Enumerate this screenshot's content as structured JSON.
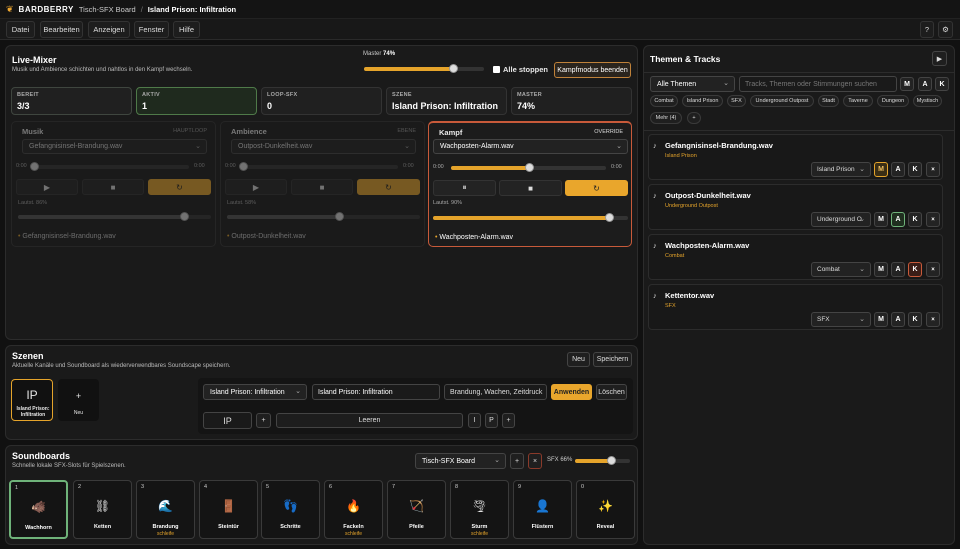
{
  "titlebar": {
    "brand": "BARDBERRY",
    "board": "Tisch-SFX Board",
    "separator": "/",
    "scene": "Island Prison: Infiltration"
  },
  "menu": [
    "Datei",
    "Bearbeiten",
    "Anzeigen",
    "Fenster",
    "Hilfe"
  ],
  "topright": {
    "help": "?",
    "settings": "⚙"
  },
  "mixer": {
    "title": "Live-Mixer",
    "subtitle": "Musik und Ambience schichten und nahtlos in den Kampf wechseln.",
    "master_label": "Master",
    "master_value": "74%",
    "master_level": 0.74,
    "stop_all": "Alle stoppen",
    "combat_end": "Kampfmodus beenden",
    "stats": [
      {
        "label": "BEREIT",
        "value": "3/3"
      },
      {
        "label": "AKTIV",
        "value": "1"
      },
      {
        "label": "LOOP-SFX",
        "value": "0"
      },
      {
        "label": "SZENE",
        "value": "Island Prison: Infiltration"
      },
      {
        "label": "MASTER",
        "value": "74%"
      }
    ],
    "channels": [
      {
        "name": "Musik",
        "tag": "HAUPTLOOP",
        "track": "Gefangnisinsel-Brandung.wav",
        "t_start": "0:00",
        "t_end": "0:00",
        "progress": 0,
        "volume_label": "Lautst. 86%",
        "volume": 0.86,
        "now": "Gefangnisinsel-Brandung.wav"
      },
      {
        "name": "Ambience",
        "tag": "EBENE",
        "track": "Outpost-Dunkelheit.wav",
        "t_start": "0:00",
        "t_end": "0:00",
        "progress": 0,
        "volume_label": "Lautst. 58%",
        "volume": 0.58,
        "now": "Outpost-Dunkelheit.wav"
      },
      {
        "name": "Kampf",
        "tag": "OVERRIDE",
        "track": "Wachposten-Alarm.wav",
        "t_start": "0:00",
        "t_end": "0:00",
        "progress": 0.5,
        "volume_label": "Lautst. 90%",
        "volume": 0.9,
        "now": "Wachposten-Alarm.wav"
      }
    ],
    "colors": {
      "accent": "#e9a62c",
      "ready": "#3f4a3f",
      "active": "#3e5b3a",
      "combat": "#c85a3a"
    }
  },
  "scenes": {
    "title": "Szenen",
    "subtitle": "Aktuelle Kanäle und Soundboard als wiederverwendbares Soundscape speichern.",
    "new": "Neu",
    "save": "Speichern",
    "card": {
      "abbr": "IP",
      "label": "Island Prison: Infiltration"
    },
    "new_card": {
      "plus": "+",
      "label": "Neu"
    },
    "select": "Island Prison: Infiltration",
    "name_value": "Island Prison: Infiltration",
    "tags_value": "Brandung, Wachen, Zeitdruck",
    "apply": "Anwenden",
    "delete": "Löschen",
    "abbr_value": "IP",
    "plus": "+",
    "clear": "Leeren",
    "i": "I",
    "p": "P",
    "plus2": "+"
  },
  "soundboards": {
    "title": "Soundboards",
    "subtitle": "Schnelle lokale SFX-Slots für Spielszenen.",
    "board": "Tisch-SFX Board",
    "plus": "+",
    "close": "×",
    "sfx_label": "SFX 66%",
    "sfx_level": 0.66,
    "slots": [
      {
        "num": "1",
        "icon": "🐗",
        "label": "Wachhorn",
        "sub": ""
      },
      {
        "num": "2",
        "icon": "⛓",
        "label": "Ketten",
        "sub": ""
      },
      {
        "num": "3",
        "icon": "🌊",
        "label": "Brandung",
        "sub": "schleife"
      },
      {
        "num": "4",
        "icon": "🚪",
        "label": "Steintür",
        "sub": ""
      },
      {
        "num": "5",
        "icon": "👣",
        "label": "Schritte",
        "sub": ""
      },
      {
        "num": "6",
        "icon": "🔥",
        "label": "Fackeln",
        "sub": "schleife"
      },
      {
        "num": "7",
        "icon": "🏹",
        "label": "Pfeile",
        "sub": ""
      },
      {
        "num": "8",
        "icon": "🌪",
        "label": "Sturm",
        "sub": "schleife"
      },
      {
        "num": "9",
        "icon": "👤",
        "label": "Flüstern",
        "sub": ""
      },
      {
        "num": "0",
        "icon": "✨",
        "label": "Reveal",
        "sub": ""
      }
    ]
  },
  "themes": {
    "title": "Themen & Tracks",
    "play": "▶",
    "filter": "Alle Themen",
    "search_placeholder": "Tracks, Themen oder Stimmungen suchen",
    "mkk": [
      "M",
      "A",
      "K"
    ],
    "chips": [
      "Combat",
      "Island Prison",
      "SFX",
      "Underground Outpost",
      "Stadt",
      "Taverne",
      "Dungeon",
      "Mystisch"
    ],
    "more": "Mehr (4)",
    "more_plus": "+",
    "tracks": [
      {
        "name": "Gefangnisinsel-Brandung.wav",
        "tag": "Island Prison",
        "theme": "Island Prison",
        "active": "M"
      },
      {
        "name": "Outpost-Dunkelheit.wav",
        "tag": "Underground Outpost",
        "theme": "Underground O",
        "active": "A"
      },
      {
        "name": "Wachposten-Alarm.wav",
        "tag": "Combat",
        "theme": "Combat",
        "active": "K"
      },
      {
        "name": "Kettentor.wav",
        "tag": "SFX",
        "theme": "SFX",
        "active": ""
      }
    ]
  }
}
